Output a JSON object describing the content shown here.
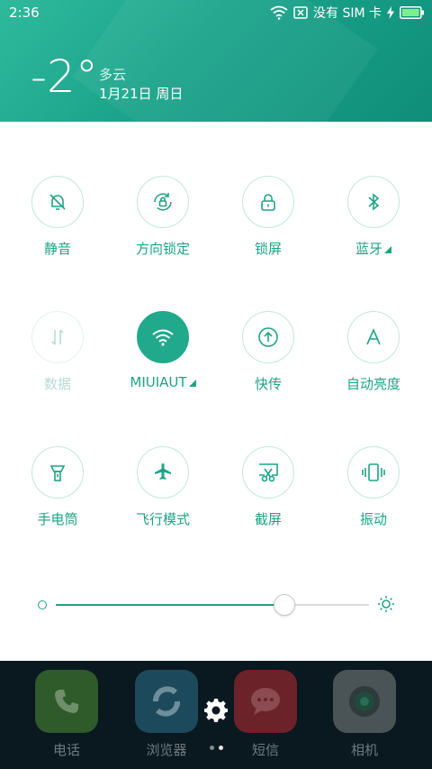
{
  "status_bar": {
    "time": "2:36",
    "no_sim": "没有 SIM 卡"
  },
  "weather": {
    "temperature": "-2°",
    "condition": "多云",
    "date": "1月21日 周日"
  },
  "toggles": [
    {
      "label": "静音",
      "icon": "bell-off-icon",
      "state": "off"
    },
    {
      "label": "方向锁定",
      "icon": "rotation-lock-icon",
      "state": "off"
    },
    {
      "label": "锁屏",
      "icon": "lock-icon",
      "state": "off"
    },
    {
      "label": "蓝牙",
      "icon": "bluetooth-icon",
      "state": "off",
      "has_more": true
    },
    {
      "label": "数据",
      "icon": "mobile-data-icon",
      "state": "disabled"
    },
    {
      "label": "MIUIAUT",
      "icon": "wifi-icon",
      "state": "on",
      "has_more": true
    },
    {
      "label": "快传",
      "icon": "quick-share-icon",
      "state": "off"
    },
    {
      "label": "自动亮度",
      "icon": "auto-brightness-icon",
      "state": "off"
    },
    {
      "label": "手电筒",
      "icon": "flashlight-icon",
      "state": "off"
    },
    {
      "label": "飞行模式",
      "icon": "airplane-icon",
      "state": "off"
    },
    {
      "label": "截屏",
      "icon": "screenshot-icon",
      "state": "off"
    },
    {
      "label": "振动",
      "icon": "vibrate-icon",
      "state": "off"
    }
  ],
  "brightness": {
    "level": 0.73
  },
  "dock": {
    "apps": [
      {
        "label": "电话",
        "color": "#2f5a2a"
      },
      {
        "label": "浏览器",
        "color": "#1c4a5c"
      },
      {
        "label": "短信",
        "color": "#6b2228"
      },
      {
        "label": "相机",
        "color": "#4a5356"
      }
    ],
    "page_dots": 2,
    "active_dot": 1
  },
  "colors": {
    "accent": "#1ea386",
    "header": "#1aa38a"
  }
}
